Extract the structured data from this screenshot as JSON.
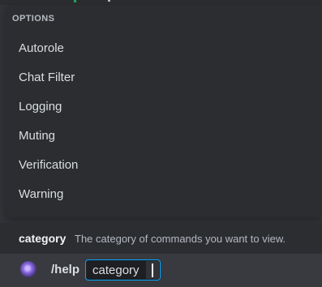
{
  "autocomplete": {
    "section_label": "OPTIONS",
    "options": [
      "Autorole",
      "Chat Filter",
      "Logging",
      "Muting",
      "Verification",
      "Warning"
    ]
  },
  "hint": {
    "param_name": "category",
    "param_description": "The category of commands you want to view."
  },
  "composer": {
    "command": "/help",
    "param_label": "category",
    "param_value": ""
  },
  "colors": {
    "background": "#313338",
    "popup": "#2b2d31",
    "composer": "#383a40",
    "focus_border": "#00a8fc",
    "online_green": "#23a55a"
  },
  "icons": {
    "bot_avatar": "bot-avatar-icon"
  }
}
